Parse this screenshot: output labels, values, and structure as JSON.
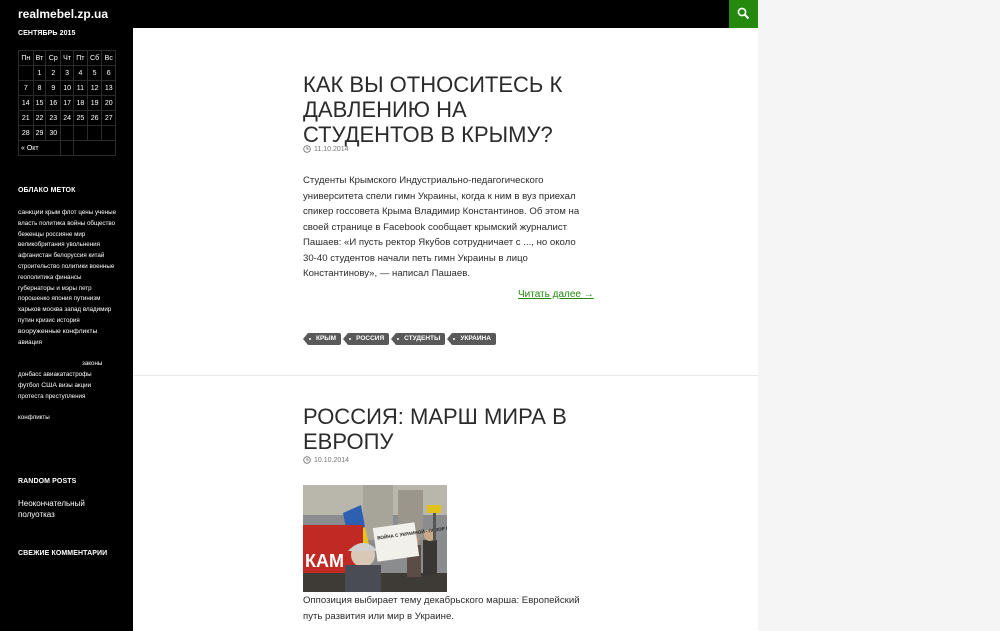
{
  "header": {
    "site_title": "realmebel.zp.ua"
  },
  "sidebar": {
    "calendar": {
      "title": "СЕНТЯБРЬ 2015",
      "weekdays": [
        "Пн",
        "Вт",
        "Ср",
        "Чт",
        "Пт",
        "Сб",
        "Вс"
      ],
      "rows": [
        [
          "",
          "1",
          "2",
          "3",
          "4",
          "5",
          "6"
        ],
        [
          "7",
          "8",
          "9",
          "10",
          "11",
          "12",
          "13"
        ],
        [
          "14",
          "15",
          "16",
          "17",
          "18",
          "19",
          "20"
        ],
        [
          "21",
          "22",
          "23",
          "24",
          "25",
          "26",
          "27"
        ],
        [
          "28",
          "29",
          "30",
          "",
          "",
          "",
          ""
        ]
      ],
      "prev_link": "« Окт"
    },
    "tag_cloud": {
      "title": "ОБЛАКО МЕТОК",
      "tags": [
        "санкции",
        "крым",
        "флот",
        "цены",
        "ученые",
        "власть",
        "политика",
        "войны",
        "общество",
        "беженцы",
        "россияне",
        "мир",
        "великобритания",
        "увольнения",
        "афганистан",
        "белоруссия",
        "китай",
        "строительство",
        "политики",
        "военные",
        "геополитика",
        "финансы",
        "губернаторы",
        "и",
        "мэры",
        "петр",
        "порошенко",
        "япония",
        "путинизм",
        "харьков",
        "москва",
        "запад",
        "владимир",
        "путин",
        "кризис",
        "история",
        "вооруженные",
        "конфликты",
        "авиация",
        "законы",
        "донбасс",
        "авиакатастрофы",
        "футбол",
        "США",
        "визы",
        "акции",
        "протеста",
        "преступления",
        "конфликты"
      ]
    },
    "random_posts": {
      "title": "RANDOM POSTS",
      "item": "Неокончательный полуотказ"
    },
    "comments": {
      "title": "СВЕЖИЕ КОММЕНТАРИИ"
    }
  },
  "posts": [
    {
      "title": "КАК ВЫ ОТНОСИТЕСЬ К ДАВЛЕНИЮ НА СТУДЕНТОВ В КРЫМУ?",
      "date": "11.10.2014",
      "excerpt": "Студенты Крымского Индустриально-педагогического университета спели гимн Украины, когда к ним в вуз приехал спикер госсовета Крыма Владимир Константинов. Об этом на своей странице в Facebook сообщает крымский журналист Пашаев: «И пусть ректор Якубов сотрудничает с ..., но около 30-40 студентов начали петь гимн Украины в лицо Константинову», — написал Пашаев.",
      "more": "Читать далее →",
      "tags": [
        "КРЫМ",
        "РОССИЯ",
        "СТУДЕНТЫ",
        "УКРАИНА"
      ]
    },
    {
      "title": "РОССИЯ: МАРШ МИРА В ЕВРОПУ",
      "date": "10.10.2014",
      "excerpt": "Оппозиция выбирает тему декабрьского марша: Европейский путь развития или мир в Украине.",
      "photo_sign": "ВОЙНА С УКРАИНОЙ - ПОЗОР РОССИИ"
    }
  ]
}
